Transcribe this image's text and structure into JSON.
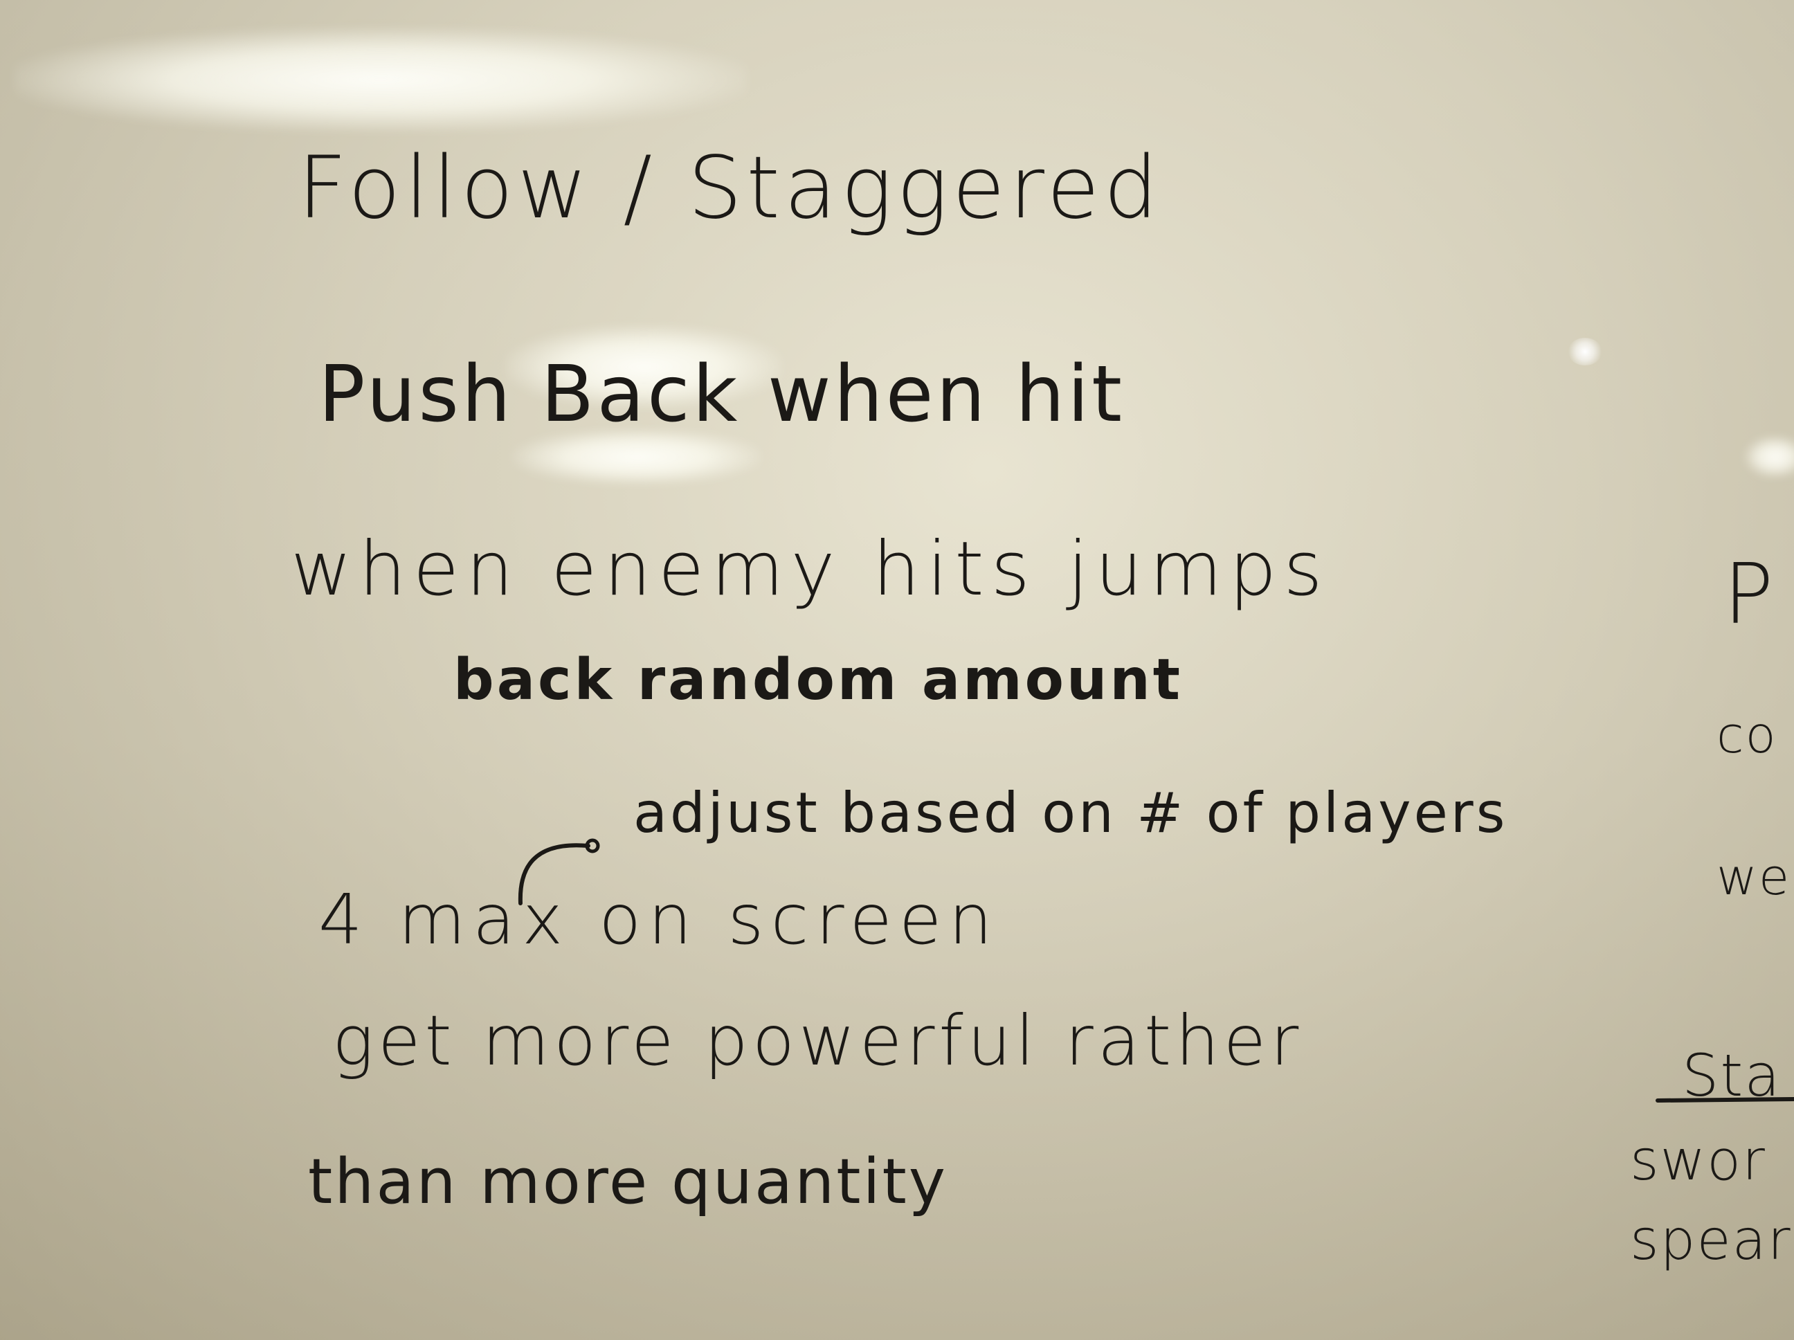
{
  "whiteboard": {
    "main_notes": {
      "title": "Follow / Staggered",
      "push_back": "Push Back when hit",
      "enemy_hits": "when enemy hits jumps",
      "back_random": "back random amount",
      "adjust": "adjust based on # of players",
      "max_on_screen": "4 max on screen",
      "more_powerful": "get more powerful rather",
      "than_quantity": "than more quantity"
    },
    "cut_off_right_column": {
      "p": "P",
      "co": "co",
      "we": "we",
      "sta": "Sta",
      "swor": "swor",
      "spea": "spear"
    }
  },
  "colors": {
    "board": "#d6d0bb",
    "ink": "#1b1916",
    "glare": "#fffff5"
  }
}
